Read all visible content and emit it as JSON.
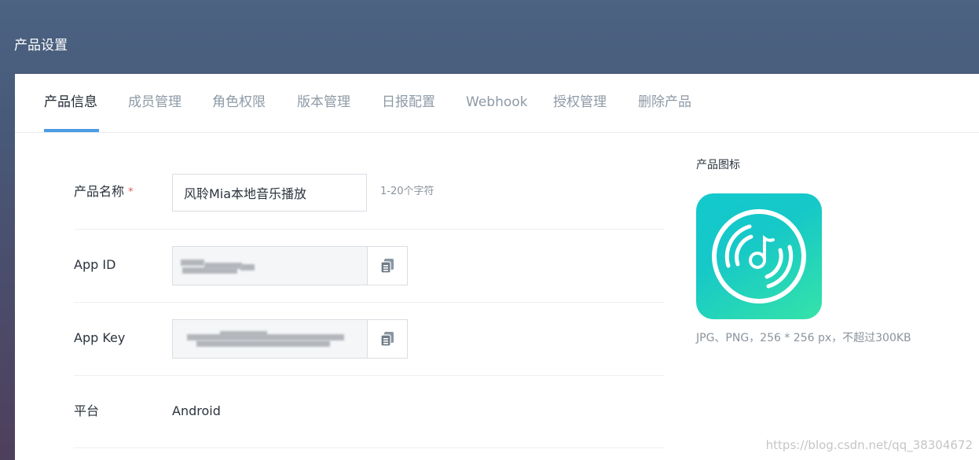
{
  "header": {
    "title": "产品设置"
  },
  "tabs": [
    {
      "label": "产品信息",
      "active": true
    },
    {
      "label": "成员管理",
      "active": false
    },
    {
      "label": "角色权限",
      "active": false
    },
    {
      "label": "版本管理",
      "active": false
    },
    {
      "label": "日报配置",
      "active": false
    },
    {
      "label": "Webhook",
      "active": false
    },
    {
      "label": "授权管理",
      "active": false
    },
    {
      "label": "删除产品",
      "active": false
    }
  ],
  "form": {
    "product_name": {
      "label": "产品名称",
      "required_mark": "*",
      "value": "风聆Mia本地音乐播放",
      "hint": "1-20个字符"
    },
    "app_id": {
      "label": "App ID",
      "value_masked": true,
      "copy_icon": "copy-icon"
    },
    "app_key": {
      "label": "App Key",
      "value_masked": true,
      "copy_icon": "copy-icon"
    },
    "platform": {
      "label": "平台",
      "value": "Android"
    }
  },
  "product_icon": {
    "label": "产品图标",
    "icon": "music-disc-icon",
    "hint": "JPG、PNG，256 * 256 px，不超过300KB"
  },
  "watermark": "https://blog.csdn.net/qq_38304672",
  "colors": {
    "header_bg": "#4a5e7e",
    "active_tab_underline": "#4a9de4",
    "icon_gradient_start": "#13c9cd",
    "icon_gradient_end": "#35e3a8",
    "required_mark": "#e25b5b"
  }
}
